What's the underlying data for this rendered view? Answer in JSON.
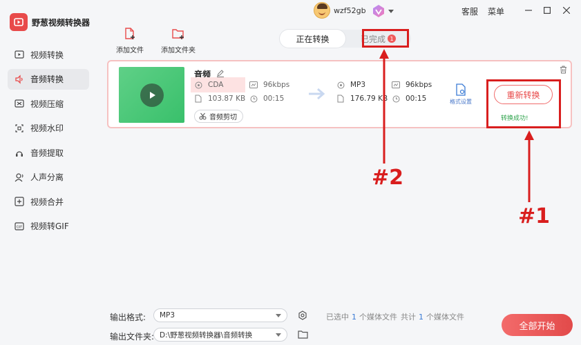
{
  "app": {
    "name": "野葱视频转换器",
    "brand_color": "#e84a4a"
  },
  "sidebar": {
    "items": [
      {
        "label": "视频转换",
        "icon": "video-convert-icon"
      },
      {
        "label": "音频转换",
        "icon": "audio-convert-icon",
        "active": true
      },
      {
        "label": "视频压缩",
        "icon": "video-compress-icon"
      },
      {
        "label": "视频水印",
        "icon": "watermark-icon"
      },
      {
        "label": "音频提取",
        "icon": "audio-extract-icon"
      },
      {
        "label": "人声分离",
        "icon": "vocal-separate-icon"
      },
      {
        "label": "视频合并",
        "icon": "video-merge-icon"
      },
      {
        "label": "视频转GIF",
        "icon": "gif-icon"
      }
    ]
  },
  "topbar": {
    "username": "wzf52gb",
    "service": "客服",
    "menu": "菜单"
  },
  "toolbar": {
    "add_file": "添加文件",
    "add_folder": "添加文件夹"
  },
  "tabs": {
    "converting": "正在转换",
    "completed": "已完成",
    "completed_count": "1"
  },
  "file": {
    "name": "音频",
    "source": {
      "format": "CDA",
      "size": "103.87 KB",
      "bitrate": "96kbps",
      "duration": "00:15"
    },
    "target": {
      "format": "MP3",
      "size": "176.79 KB",
      "bitrate": "96kbps",
      "duration": "00:15"
    },
    "cut_label": "音频剪切",
    "format_setting": "格式设置",
    "reconvert": "重新转换",
    "status": "转换成功!"
  },
  "annotations": {
    "label1": "#1",
    "label2": "#2",
    "color": "#d91e1e"
  },
  "bottom": {
    "format_label": "输出格式:",
    "format_value": "MP3",
    "folder_label": "输出文件夹:",
    "folder_value": "D:\\野葱视频转换器\\音频转换",
    "selected_prefix": "已选中",
    "selected_count": "1",
    "selected_suffix": "个媒体文件",
    "total_prefix": "共计",
    "total_count": "1",
    "total_suffix": "个媒体文件",
    "start": "全部开始"
  }
}
